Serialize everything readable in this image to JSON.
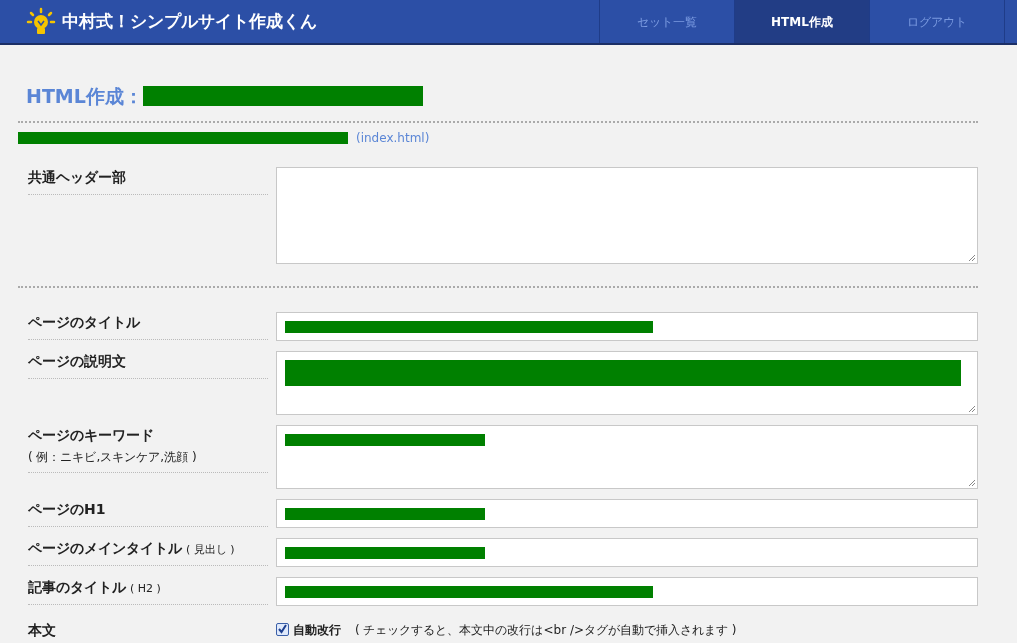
{
  "app": {
    "title": "中村式！シンプルサイト作成くん"
  },
  "nav": [
    {
      "label": "セット一覧",
      "selected": false
    },
    {
      "label": "HTML作成",
      "selected": true
    },
    {
      "label": "ログアウト",
      "selected": false
    }
  ],
  "heading": {
    "text": "HTML作成：",
    "redacted": true
  },
  "page_link": {
    "redacted": true,
    "file": "(index.html)"
  },
  "header_section": {
    "label": "共通ヘッダー部"
  },
  "fields": [
    {
      "label": "ページのタイトル",
      "kind": "input",
      "redacted": true
    },
    {
      "label": "ページの説明文",
      "kind": "textarea",
      "redacted": true
    },
    {
      "label": "ページのキーワード",
      "hint": "( 例：ニキビ,スキンケア,洗顔 )",
      "kind": "textarea",
      "redacted": true
    },
    {
      "label": "ページのH1",
      "kind": "input",
      "redacted": true
    },
    {
      "label": "ページのメインタイトル",
      "suffix": "( 見出し )",
      "kind": "input",
      "redacted": true
    },
    {
      "label": "記事のタイトル",
      "suffix": "( H2 )",
      "kind": "input",
      "redacted": true
    }
  ],
  "body": {
    "label": "本文",
    "checkbox": {
      "label": "自動改行",
      "checked": true
    },
    "note": "( チェックすると、本文中の改行は<br />タグが自動で挿入されます )"
  }
}
